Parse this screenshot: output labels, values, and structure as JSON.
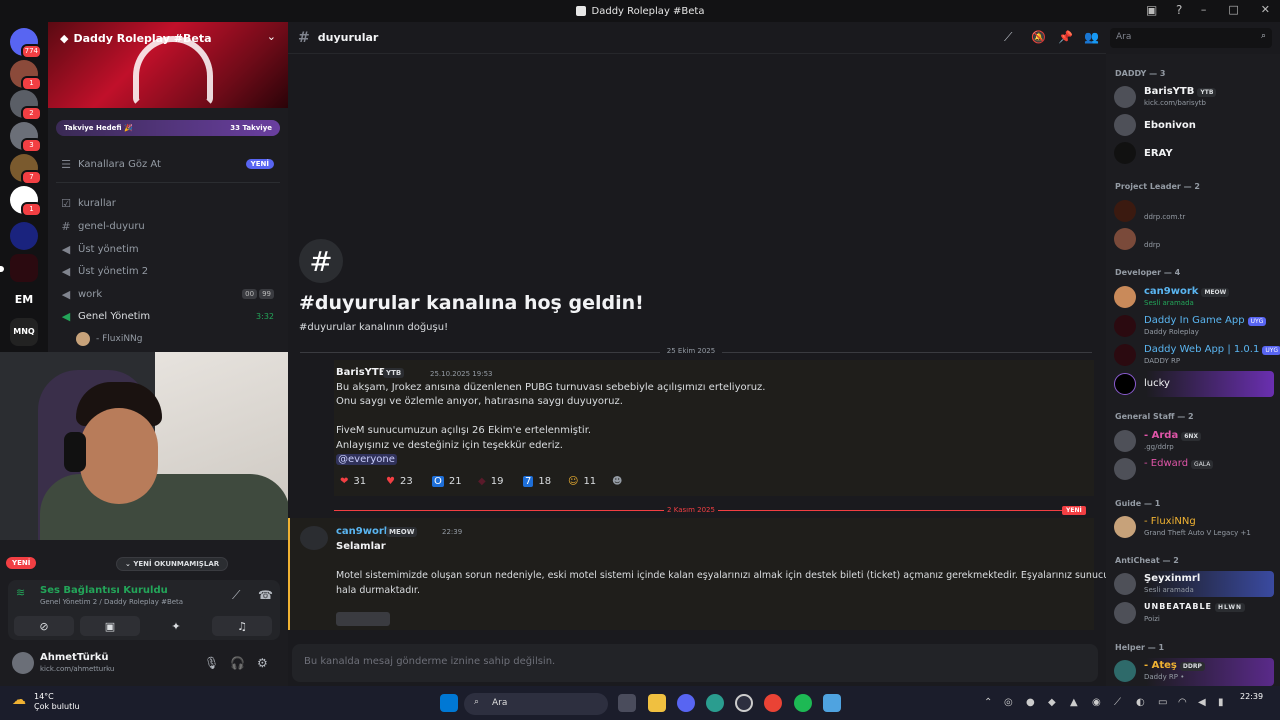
{
  "window": {
    "title": "Daddy Roleplay #Beta"
  },
  "servers": {
    "badges": [
      "774",
      "1",
      "2",
      "3",
      "7",
      "1"
    ],
    "labels": [
      "EM",
      "MNQ"
    ]
  },
  "server": {
    "name": "Daddy Roleplay #Beta",
    "boost_label": "Takviye Hedefi 🎉",
    "boost_count": "33 Takviye",
    "browse": "Kanallara Göz At",
    "browse_badge": "YENİ",
    "channels": [
      {
        "name": "kurallar",
        "icon": "rules-icon"
      },
      {
        "name": "genel-duyuru",
        "icon": "hash-icon"
      },
      {
        "name": "Üst yönetim",
        "icon": "speaker-icon"
      },
      {
        "name": "Üst yönetim 2",
        "icon": "speaker-icon"
      },
      {
        "name": "work",
        "icon": "speaker-icon",
        "counts": [
          "00",
          "99"
        ]
      },
      {
        "name": "Genel Yönetim",
        "icon": "speaker-icon",
        "timer": "3:32"
      }
    ],
    "voice_user": "- FluxiNNg"
  },
  "voice": {
    "unread_pill": "YENİ OKUNMAMIŞLAR",
    "new_side": "YENİ",
    "status": "Ses Bağlantısı Kuruldu",
    "sub": "Genel Yönetim 2 / Daddy Roleplay #Beta"
  },
  "user": {
    "name": "AhmetTürkü",
    "status": "kick.com/ahmetturku"
  },
  "channel": {
    "name": "duyurular",
    "search_placeholder": "Ara",
    "welcome_title": "#duyurular kanalına hoş geldin!",
    "welcome_sub": "#duyurular kanalının doğuşu!",
    "composer": "Bu kanalda mesaj gönderme iznine sahip değilsin."
  },
  "messages": [
    {
      "date": "25 Ekim 2025",
      "author": "BarisYTB",
      "tag": "YTB",
      "timestamp": "25.10.2025 19:53",
      "lines": [
        "Bu akşam, Jrokez anısına düzenlenen PUBG turnuvası sebebiyle açılışımızı erteliyoruz.",
        "Onu saygı ve özlemle anıyor, hatırasına saygı duyuyoruz.",
        "FiveM sunucumuzun açılışı 26 Ekim'e ertelenmiştir.",
        "Anlayışınız ve desteğiniz için teşekkür ederiz."
      ],
      "mention": "@everyone",
      "reactions": [
        {
          "emoji": "❤",
          "count": "31"
        },
        {
          "emoji": "♥",
          "count": "23"
        },
        {
          "emoji": "O",
          "count": "21"
        },
        {
          "emoji": "◆",
          "count": "19"
        },
        {
          "emoji": "7",
          "count": "18"
        },
        {
          "emoji": "☺",
          "count": "11"
        }
      ]
    },
    {
      "date": "2 Kasım 2025",
      "new_label": "YENİ",
      "author": "can9work",
      "tag": "MEOW",
      "timestamp": "22:39",
      "heading": "Selamlar",
      "lines": [
        "Motel sistemimizde oluşan sorun nedeniyle, eski motel sistemi içinde kalan eşyalarınızı almak için destek bileti (ticket) açmanız gerekmektedir. Eşyalarınız sunucuda",
        "hala durmaktadır."
      ]
    }
  ],
  "members": {
    "groups": [
      {
        "title": "DADDY — 3"
      },
      {
        "title": "Project Leader — 2"
      },
      {
        "title": "Developer — 4"
      },
      {
        "title": "General Staff — 2"
      },
      {
        "title": "Guide — 1"
      },
      {
        "title": "AntiCheat — 2"
      },
      {
        "title": "Helper — 1"
      }
    ],
    "list": [
      {
        "name": "BarisYTB",
        "tag": "YTB",
        "sub": "kick.com/barisytb",
        "color": "#f2f3f5"
      },
      {
        "name": "Ebonivon",
        "tag": "",
        "sub": "",
        "color": "#f2f3f5"
      },
      {
        "name": "ERAY",
        "tag": "",
        "sub": "",
        "color": "#f2f3f5"
      },
      {
        "name": "",
        "tag": "",
        "sub": "ddrp.com.tr",
        "color": "#f2f3f5"
      },
      {
        "name": "",
        "tag": "",
        "sub": "ddrp",
        "color": "#f2f3f5"
      },
      {
        "name": "can9work",
        "tag": "MEOW",
        "sub": "Sesli aramada",
        "color": "#5ab5f0"
      },
      {
        "name": "Daddy In Game App",
        "tag": "UYG",
        "sub": "Daddy Roleplay",
        "color": "#5ab5f0"
      },
      {
        "name": "Daddy Web App | 1.0.1",
        "tag": "UYG",
        "sub": "DADDY RP",
        "color": "#5ab5f0"
      },
      {
        "name": "lucky",
        "tag": "",
        "sub": "",
        "color": "#ffffff"
      },
      {
        "name": "- Arda",
        "tag": "6NX",
        "sub": ".gg/ddrp",
        "color": "#e055a8"
      },
      {
        "name": "- Edward",
        "tag": "GALA",
        "sub": "",
        "color": "#e055a8"
      },
      {
        "name": "- FluxiNNg",
        "tag": "",
        "sub": "Grand Theft Auto V Legacy +1",
        "color": "#f0b232"
      },
      {
        "name": "Şeyxinmrl",
        "tag": "",
        "sub": "Sesli aramada",
        "color": "#ffffff"
      },
      {
        "name": "UNBEATABLE",
        "tag": "HLWN",
        "sub": "Poizi",
        "color": "#dbdee1"
      },
      {
        "name": "- Ateş",
        "tag": "DDRP",
        "sub": "Daddy RP •",
        "color": "#f0b232"
      }
    ]
  },
  "taskbar": {
    "weather_temp": "14°C",
    "weather_desc": "Çok bulutlu",
    "search": "Ara",
    "time": "22:39"
  }
}
